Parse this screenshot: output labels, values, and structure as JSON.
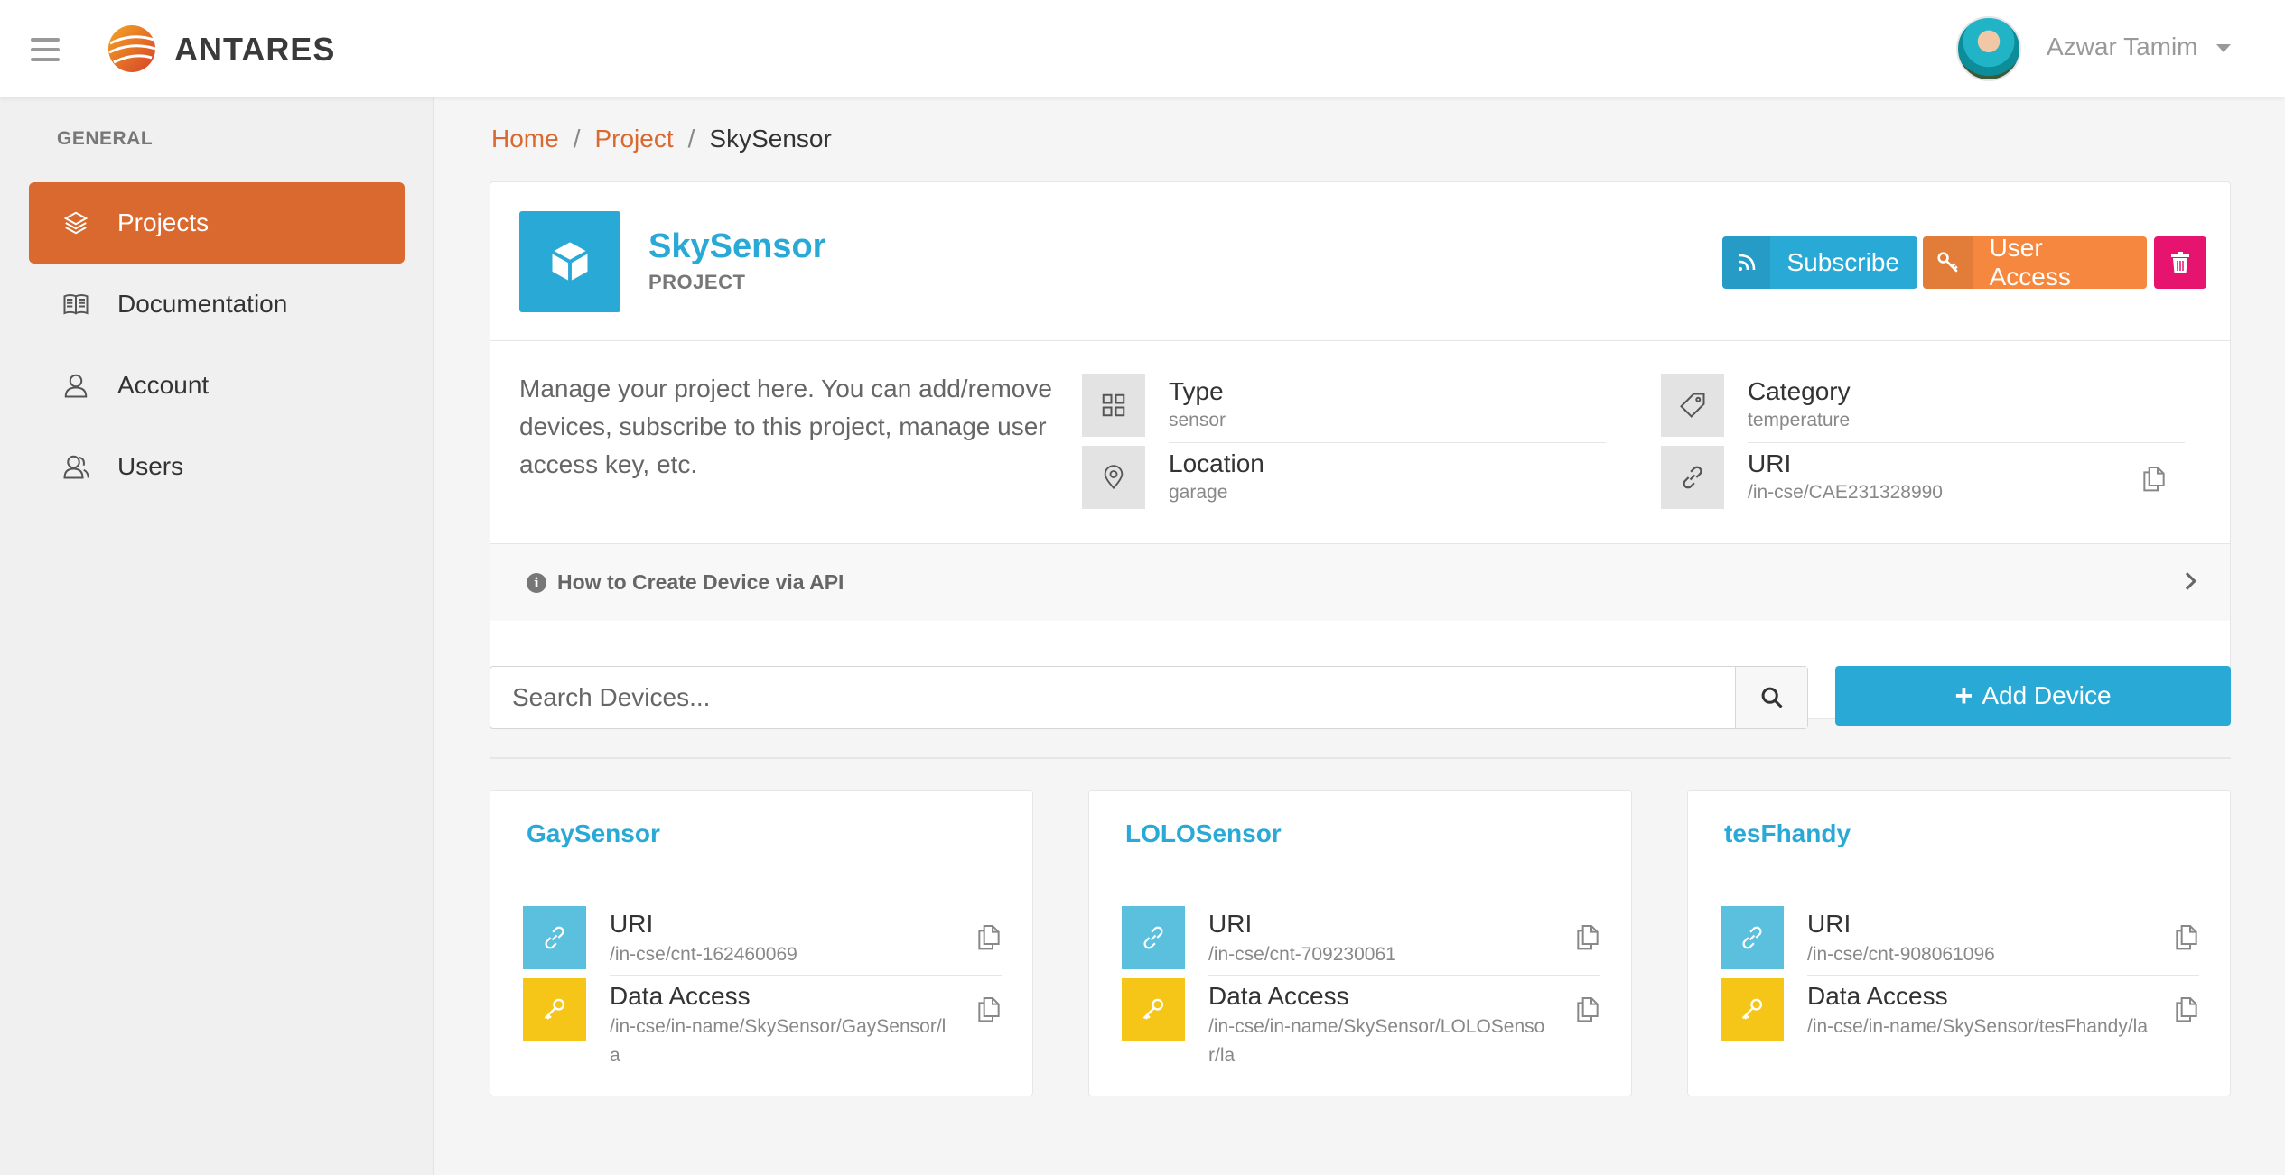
{
  "app": {
    "brand": "ANTARES"
  },
  "user": {
    "name": "Azwar Tamim"
  },
  "sidebar": {
    "header": "GENERAL",
    "items": [
      {
        "label": "Projects",
        "icon": "layers-icon",
        "active": true
      },
      {
        "label": "Documentation",
        "icon": "book-icon",
        "active": false
      },
      {
        "label": "Account",
        "icon": "user-icon",
        "active": false
      },
      {
        "label": "Users",
        "icon": "users-icon",
        "active": false
      }
    ]
  },
  "breadcrumb": {
    "home": "Home",
    "project": "Project",
    "current": "SkySensor",
    "separator": "/"
  },
  "project": {
    "title": "SkySensor",
    "subtitle": "PROJECT",
    "description": "Manage your project here. You can add/remove devices, subscribe to this project, manage user access key, etc.",
    "buttons": {
      "subscribe": "Subscribe",
      "user_access": "User Access"
    },
    "info": {
      "type_label": "Type",
      "type_value": "sensor",
      "category_label": "Category",
      "category_value": "temperature",
      "location_label": "Location",
      "location_value": "garage",
      "uri_label": "URI",
      "uri_value": "/in-cse/CAE231328990"
    },
    "howto": "How to Create Device via API"
  },
  "search": {
    "placeholder": "Search Devices..."
  },
  "add_device": {
    "label": "Add Device"
  },
  "devices": [
    {
      "name": "GaySensor",
      "uri_label": "URI",
      "uri": "/in-cse/cnt-162460069",
      "access_label": "Data Access",
      "access": "/in-cse/in-name/SkySensor/GaySensor/la"
    },
    {
      "name": "LOLOSensor",
      "uri_label": "URI",
      "uri": "/in-cse/cnt-709230061",
      "access_label": "Data Access",
      "access": "/in-cse/in-name/SkySensor/LOLOSensor/la"
    },
    {
      "name": "tesFhandy",
      "uri_label": "URI",
      "uri": "/in-cse/cnt-908061096",
      "access_label": "Data Access",
      "access": "/in-cse/in-name/SkySensor/tesFhandy/la"
    }
  ],
  "colors": {
    "accent": "#d9692e",
    "primary": "#29a9d6",
    "warning": "#f5883e",
    "danger": "#e6146e",
    "uri_box": "#5bc0de",
    "access_box": "#f5c518"
  }
}
